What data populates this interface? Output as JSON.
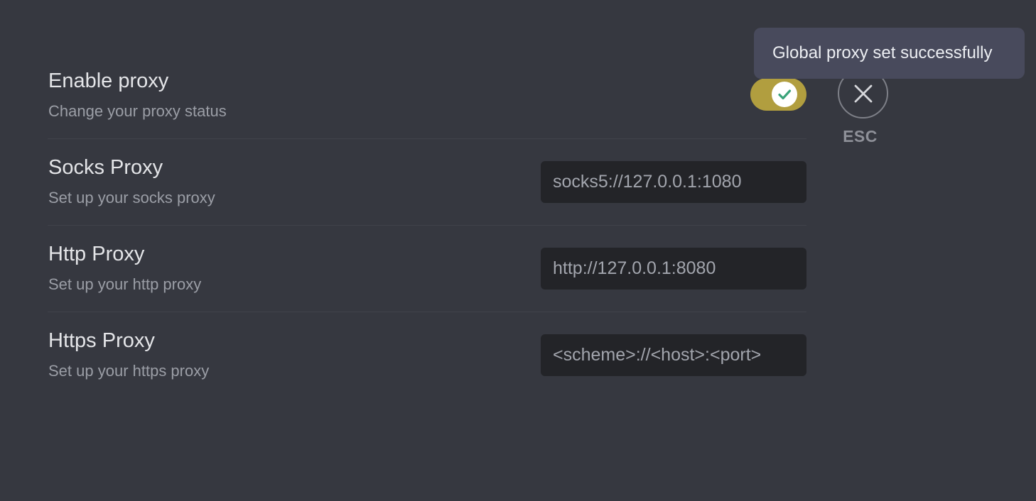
{
  "settings": {
    "enable_proxy": {
      "title": "Enable proxy",
      "description": "Change your proxy status",
      "enabled": true
    },
    "socks_proxy": {
      "title": "Socks Proxy",
      "description": "Set up your socks proxy",
      "value": "socks5://127.0.0.1:1080",
      "placeholder": "<scheme>://<host>:<port>"
    },
    "http_proxy": {
      "title": "Http Proxy",
      "description": "Set up your http proxy",
      "value": "http://127.0.0.1:8080",
      "placeholder": "<scheme>://<host>:<port>"
    },
    "https_proxy": {
      "title": "Https Proxy",
      "description": "Set up your https proxy",
      "value": "",
      "placeholder": "<scheme>://<host>:<port>"
    }
  },
  "close": {
    "label": "ESC",
    "icon": "close-icon"
  },
  "toast": {
    "message": "Global proxy set successfully"
  },
  "colors": {
    "background": "#363840",
    "toggle_on": "#b19e3f",
    "check": "#3aa37a",
    "input_bg": "#232428",
    "toast_bg": "#484a5c"
  }
}
